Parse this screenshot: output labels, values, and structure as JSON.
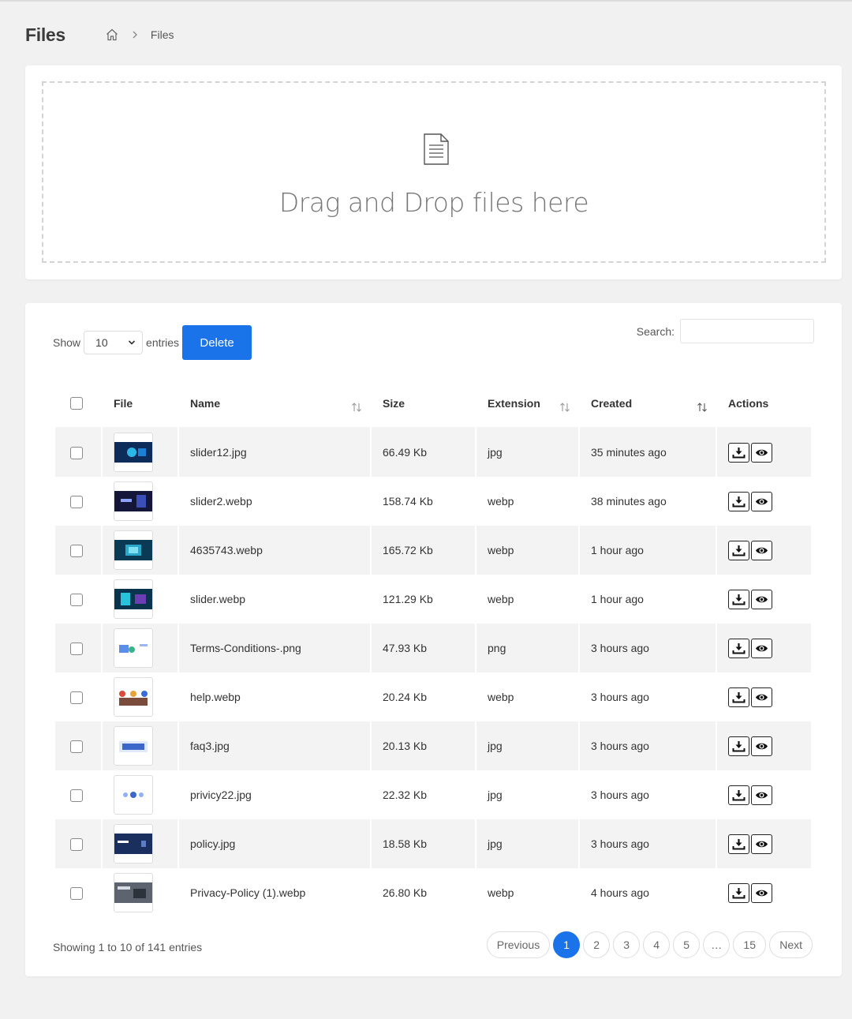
{
  "header": {
    "title": "Files",
    "breadcrumb_current": "Files"
  },
  "upload": {
    "dropzone_text": "Drag and Drop files here"
  },
  "controls": {
    "show_label": "Show",
    "entries_label": "entries",
    "page_length": "10",
    "delete_label": "Delete",
    "search_label": "Search:",
    "search_value": ""
  },
  "table": {
    "columns": {
      "file": "File",
      "name": "Name",
      "size": "Size",
      "extension": "Extension",
      "created": "Created",
      "actions": "Actions"
    },
    "rows": [
      {
        "name": "slider12.jpg",
        "size": "66.49 Kb",
        "extension": "jpg",
        "created": "35 minutes ago"
      },
      {
        "name": "slider2.webp",
        "size": "158.74 Kb",
        "extension": "webp",
        "created": "38 minutes ago"
      },
      {
        "name": "4635743.webp",
        "size": "165.72 Kb",
        "extension": "webp",
        "created": "1 hour ago"
      },
      {
        "name": "slider.webp",
        "size": "121.29 Kb",
        "extension": "webp",
        "created": "1 hour ago"
      },
      {
        "name": "Terms-Conditions-.png",
        "size": "47.93 Kb",
        "extension": "png",
        "created": "3 hours ago"
      },
      {
        "name": "help.webp",
        "size": "20.24 Kb",
        "extension": "webp",
        "created": "3 hours ago"
      },
      {
        "name": "faq3.jpg",
        "size": "20.13 Kb",
        "extension": "jpg",
        "created": "3 hours ago"
      },
      {
        "name": "privicy22.jpg",
        "size": "22.32 Kb",
        "extension": "jpg",
        "created": "3 hours ago"
      },
      {
        "name": "policy.jpg",
        "size": "18.58 Kb",
        "extension": "jpg",
        "created": "3 hours ago"
      },
      {
        "name": "Privacy-Policy (1).webp",
        "size": "26.80 Kb",
        "extension": "webp",
        "created": "4 hours ago"
      }
    ]
  },
  "footer": {
    "info": "Showing 1 to 10 of 141 entries",
    "pagination": {
      "previous": "Previous",
      "pages": [
        "1",
        "2",
        "3",
        "4",
        "5",
        "…",
        "15"
      ],
      "next": "Next"
    }
  },
  "colors": {
    "accent": "#1a73e8",
    "background": "#f1f1f2",
    "row_stripe": "#f3f3f3"
  },
  "icons": {
    "home": "home-icon",
    "separator": "chevron-right-icon",
    "document": "document-icon",
    "download": "download-icon",
    "view": "eye-icon",
    "sort": "sort-icon"
  }
}
